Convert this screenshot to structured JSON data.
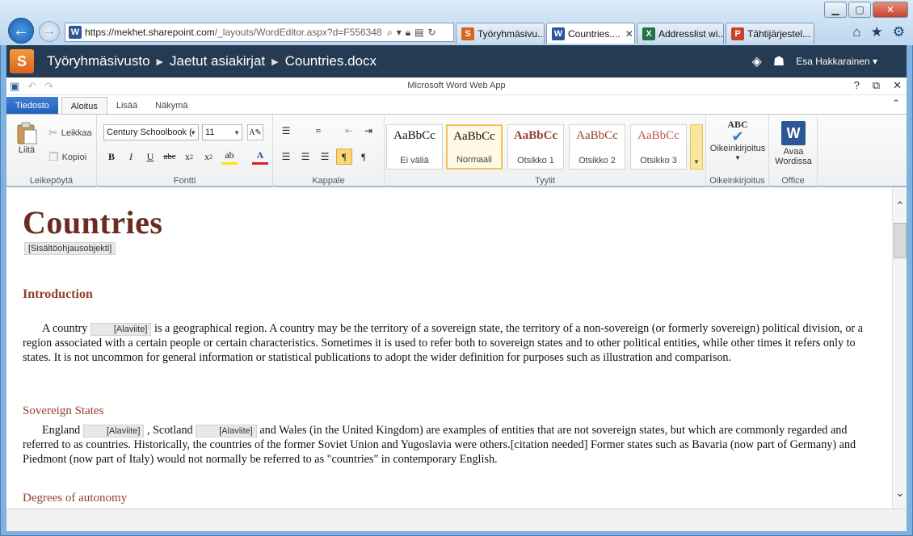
{
  "browser": {
    "url": "https://mekhet.sharepoint.com/_layouts/WordEditor.aspx?d=F556348",
    "url_host": "https://mekhet.sharepoint.com",
    "url_rest": "/_layouts/WordEditor.aspx?d=F556348",
    "tabs": [
      {
        "label": "Työryhmäsivu...",
        "icon": "sharepoint-icon",
        "color": "#d9641e",
        "glyph": "S"
      },
      {
        "label": "Countries....",
        "icon": "word-icon",
        "color": "#2b5797",
        "glyph": "W"
      },
      {
        "label": "Addresslist wi...",
        "icon": "excel-icon",
        "color": "#217346",
        "glyph": "X"
      },
      {
        "label": "Tähtijärjestel...",
        "icon": "powerpoint-icon",
        "color": "#c5432a",
        "glyph": "P"
      }
    ]
  },
  "sharepoint": {
    "logo_glyph": "S",
    "crumbs": [
      "Työryhmäsivusto",
      "Jaetut asiakirjat",
      "Countries.docx"
    ],
    "user": "Esa Hakkarainen ▾"
  },
  "app": {
    "title": "Microsoft Word Web App"
  },
  "ribbon_tabs": {
    "file": "Tiedosto",
    "home": "Aloitus",
    "insert": "Lisää",
    "view": "Näkymä"
  },
  "ribbon": {
    "clipboard": {
      "label": "Leikepöytä",
      "paste": "Liitä",
      "cut": "Leikkaa",
      "copy": "Kopioi"
    },
    "font": {
      "label": "Fontti",
      "font_name": "Century Schoolbook (",
      "font_size": "11"
    },
    "paragraph": {
      "label": "Kappale"
    },
    "styles": {
      "label": "Tyylit",
      "items": [
        {
          "sample": "AaBbCc",
          "name": "Ei väliä"
        },
        {
          "sample": "AaBbCc",
          "name": "Normaali"
        },
        {
          "sample": "AaBbCc",
          "name": "Otsikko 1"
        },
        {
          "sample": "AaBbCc",
          "name": "Otsikko 2"
        },
        {
          "sample": "AaBbCc",
          "name": "Otsikko 3"
        }
      ]
    },
    "proofing": {
      "label": "Oikeinkirjoitus",
      "button": "Oikeinkirjoitus",
      "abc": "ABC"
    },
    "office": {
      "label": "Office",
      "button_line1": "Avaa",
      "button_line2": "Wordissa"
    }
  },
  "document": {
    "title": "Countries",
    "title_control": "[Sisältöohjausobjekti]",
    "sections": [
      {
        "heading": "Introduction",
        "para_parts": [
          "A country ",
          "[Alaviite]",
          " is a geographical region. A country may be the territory of a sovereign state, the territory of a non-sovereign (or formerly sovereign) political division, or a region associated with a certain people or certain characteristics. Sometimes it is used to refer both to sovereign states and to other political entities, while other times it refers only to states. It is not uncommon for general information or statistical publications to adopt the wider definition for purposes such as illustration and comparison."
        ]
      },
      {
        "heading": "Sovereign States",
        "para_parts": [
          "England ",
          "[Alaviite]",
          " , Scotland ",
          "[Alaviite]",
          " and Wales (in the United Kingdom) are examples of entities that are not sovereign states, but which are commonly regarded and referred to as countries. Historically, the countries of the former Soviet Union and Yugoslavia were others.[citation needed] Former states such as Bavaria (now part of Germany) and Piedmont (now part of Italy) would not normally be referred to as \"countries\" in contemporary English."
        ]
      },
      {
        "heading": "Degrees of autonomy"
      }
    ]
  }
}
